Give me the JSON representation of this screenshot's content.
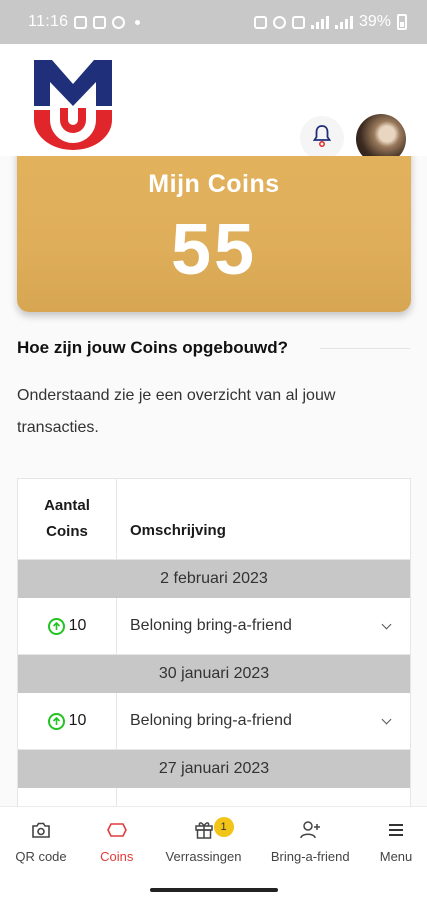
{
  "status_bar": {
    "time": "11:16",
    "battery": "39%"
  },
  "header": {
    "logo_icon": "mu-logo-icon",
    "bell_icon": "bell-icon",
    "avatar_icon": "avatar"
  },
  "coins_card": {
    "title": "Mijn Coins",
    "value": "55"
  },
  "section": {
    "title": "Hoe zijn jouw Coins opgebouwd?",
    "description": "Onderstaand zie je een overzicht van al jouw transacties."
  },
  "table": {
    "headers": {
      "amount": "Aantal Coins",
      "description": "Omschrijving"
    },
    "groups": [
      {
        "date": "2 februari 2023",
        "rows": [
          {
            "amount": "10",
            "description": "Beloning bring-a-friend"
          }
        ]
      },
      {
        "date": "30 januari 2023",
        "rows": [
          {
            "amount": "10",
            "description": "Beloning bring-a-friend"
          }
        ]
      },
      {
        "date": "27 januari 2023",
        "rows": []
      }
    ]
  },
  "bottom_nav": {
    "items": [
      {
        "label": "QR code",
        "icon": "camera-icon"
      },
      {
        "label": "Coins",
        "icon": "coins-icon",
        "active": true
      },
      {
        "label": "Verrassingen",
        "icon": "gift-icon",
        "badge": "1"
      },
      {
        "label": "Bring-a-friend",
        "icon": "add-user-icon"
      },
      {
        "label": "Menu",
        "icon": "menu-icon"
      }
    ]
  },
  "colors": {
    "brand_blue": "#1f2f7a",
    "brand_red": "#e0262a",
    "card_gold": "#e2b25c",
    "active_nav": "#e23b3b",
    "coin_green": "#22c322",
    "badge_yellow": "#f2c417"
  }
}
